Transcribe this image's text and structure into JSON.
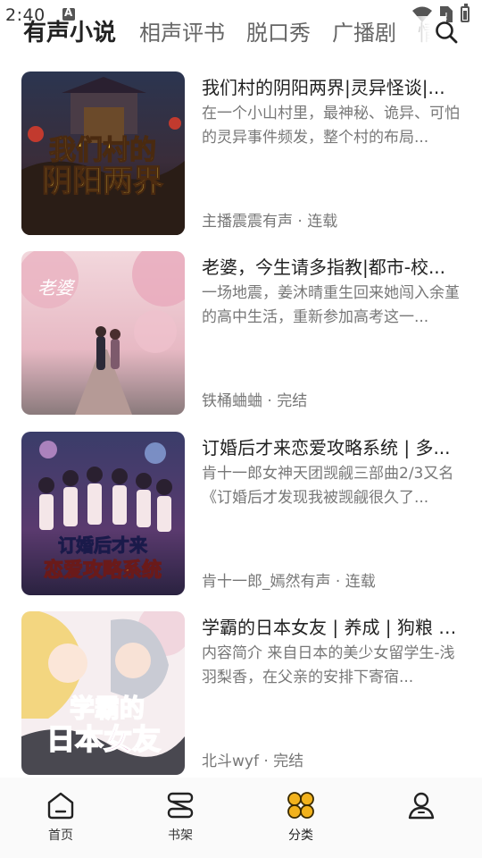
{
  "status_bar": {
    "time": "2:40"
  },
  "tabs": [
    {
      "label": "有声小说",
      "active": true
    },
    {
      "label": "相声评书",
      "active": false
    },
    {
      "label": "脱口秀",
      "active": false
    },
    {
      "label": "广播剧",
      "active": false
    },
    {
      "label": "情",
      "active": false
    }
  ],
  "icons": {
    "search": "search-icon",
    "home": "home-icon",
    "bookshelf": "bookshelf-icon",
    "category": "category-icon",
    "profile": "profile-icon"
  },
  "colors": {
    "accent": "#f2b21c",
    "text_primary": "#222222",
    "text_secondary": "#777777"
  },
  "books": [
    {
      "title": "我们村的阴阳两界|灵异怪谈|...",
      "description": "在一个小山村里，最神秘、诡异、可怕的灵异事件频发，整个村的布局...",
      "meta": "主播震震有声 · 连载",
      "cover_text": "我们村的\n阴阳两界"
    },
    {
      "title": "老婆，今生请多指教|都市-校...",
      "description": "一场地震，姜沐晴重生回来她闯入余堇的高中生活，重新参加高考这一...",
      "meta": "铁桶蛐蛐 · 完结",
      "cover_text": "老婆"
    },
    {
      "title": "订婚后才来恋爱攻略系统 | 多...",
      "description": "肯十一郎女神天团觊觎三部曲2/3又名《订婚后才发现我被觊觎很久了...",
      "meta": "肯十一郎_嫣然有声 · 连载",
      "cover_text": "订婚后才来\n恋爱攻略系统"
    },
    {
      "title": "学霸的日本女友 | 养成 | 狗粮 | ...",
      "description": "内容简介 来自日本的美少女留学生-浅羽梨香，在父亲的安排下寄宿...",
      "meta": "北斗wyf · 完结",
      "cover_text": "学霸的\n日本女友"
    }
  ],
  "bottom_nav": [
    {
      "label": "首页",
      "icon": "home-icon",
      "active": false
    },
    {
      "label": "书架",
      "icon": "bookshelf-icon",
      "active": false
    },
    {
      "label": "分类",
      "icon": "category-icon",
      "active": true
    },
    {
      "label": "",
      "icon": "profile-icon",
      "active": false
    }
  ]
}
